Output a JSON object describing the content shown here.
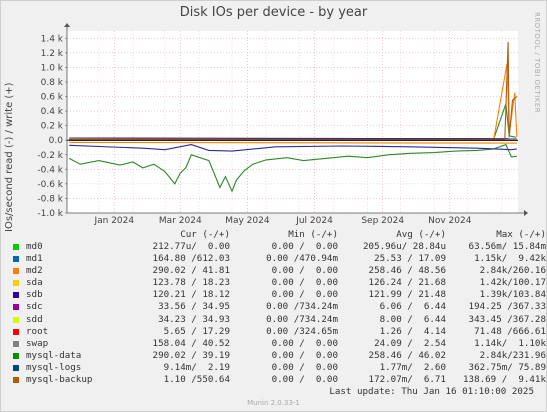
{
  "chart_data": {
    "type": "line",
    "title": "Disk IOs per device - by year",
    "ylabel": "IOs/second read (-) / write (+)",
    "ylim": [
      -1000,
      1500
    ],
    "y_ticks": [
      "1.4 k",
      "1.2 k",
      "1.0 k",
      "0.8 k",
      "0.6 k",
      "0.4 k",
      "0.2 k",
      "0.0",
      "-0.2 k",
      "-0.4 k",
      "-0.6 k",
      "-0.8 k",
      "-1.0 k"
    ],
    "y_tick_values": [
      1400,
      1200,
      1000,
      800,
      600,
      400,
      200,
      0,
      -200,
      -400,
      -600,
      -800,
      -1000
    ],
    "x_range": [
      "2023-12-03",
      "2025-01-16"
    ],
    "x_ticks": [
      {
        "label": "Jan 2024",
        "date": "2024-01-15"
      },
      {
        "label": "Mar 2024",
        "date": "2024-03-15"
      },
      {
        "label": "May 2024",
        "date": "2024-05-15"
      },
      {
        "label": "Jul 2024",
        "date": "2024-07-15"
      },
      {
        "label": "Sep 2024",
        "date": "2024-09-15"
      },
      {
        "label": "Nov 2024",
        "date": "2024-11-15"
      }
    ],
    "grid": true,
    "series_summary_note": "",
    "series": [
      {
        "name": "mysql-data",
        "color": "#2a8a2a",
        "write": [
          [
            "2023-12-05",
            10
          ],
          [
            "2024-03-01",
            15
          ],
          [
            "2024-04-10",
            10
          ],
          [
            "2024-07-01",
            12
          ],
          [
            "2024-10-01",
            14
          ],
          [
            "2024-12-25",
            20
          ],
          [
            "2025-01-05",
            500
          ],
          [
            "2025-01-08",
            60
          ],
          [
            "2025-01-14",
            40
          ]
        ],
        "read": [
          [
            "2023-12-05",
            -250
          ],
          [
            "2023-12-15",
            -330
          ],
          [
            "2024-01-01",
            -280
          ],
          [
            "2024-01-20",
            -340
          ],
          [
            "2024-02-01",
            -300
          ],
          [
            "2024-02-10",
            -380
          ],
          [
            "2024-02-20",
            -330
          ],
          [
            "2024-03-01",
            -430
          ],
          [
            "2024-03-10",
            -600
          ],
          [
            "2024-03-15",
            -450
          ],
          [
            "2024-03-20",
            -380
          ],
          [
            "2024-03-25",
            -200
          ],
          [
            "2024-04-10",
            -280
          ],
          [
            "2024-04-20",
            -650
          ],
          [
            "2024-04-25",
            -500
          ],
          [
            "2024-05-01",
            -700
          ],
          [
            "2024-05-05",
            -550
          ],
          [
            "2024-05-12",
            -420
          ],
          [
            "2024-05-20",
            -330
          ],
          [
            "2024-06-01",
            -270
          ],
          [
            "2024-06-20",
            -240
          ],
          [
            "2024-07-05",
            -280
          ],
          [
            "2024-07-25",
            -250
          ],
          [
            "2024-08-15",
            -220
          ],
          [
            "2024-09-01",
            -240
          ],
          [
            "2024-09-20",
            -200
          ],
          [
            "2024-10-10",
            -180
          ],
          [
            "2024-11-01",
            -170
          ],
          [
            "2024-11-20",
            -150
          ],
          [
            "2024-12-10",
            -140
          ],
          [
            "2024-12-25",
            -120
          ],
          [
            "2025-01-05",
            -60
          ],
          [
            "2025-01-10",
            -230
          ],
          [
            "2025-01-15",
            -220
          ]
        ]
      },
      {
        "name": "md2",
        "color": "#ff7f00",
        "write": [
          [
            "2023-12-05",
            12
          ],
          [
            "2024-12-25",
            20
          ],
          [
            "2025-01-06",
            1050
          ],
          [
            "2025-01-08",
            80
          ],
          [
            "2025-01-13",
            650
          ],
          [
            "2025-01-15",
            40
          ]
        ],
        "read": [
          [
            "2023-12-05",
            -30
          ],
          [
            "2025-01-15",
            -40
          ]
        ]
      },
      {
        "name": "sdb",
        "color": "#2a2a9a",
        "write": [
          [
            "2023-12-05",
            30
          ],
          [
            "2025-01-15",
            20
          ]
        ],
        "read": [
          [
            "2023-12-05",
            -70
          ],
          [
            "2024-02-10",
            -110
          ],
          [
            "2024-03-01",
            -130
          ],
          [
            "2024-03-25",
            -60
          ],
          [
            "2024-04-10",
            -140
          ],
          [
            "2024-05-01",
            -150
          ],
          [
            "2024-06-10",
            -90
          ],
          [
            "2024-08-10",
            -80
          ],
          [
            "2024-10-10",
            -90
          ],
          [
            "2024-12-10",
            -110
          ],
          [
            "2025-01-10",
            -130
          ],
          [
            "2025-01-15",
            -120
          ]
        ]
      },
      {
        "name": "mysql-backup",
        "color": "#b05c10",
        "write": [
          [
            "2023-12-05",
            5
          ],
          [
            "2025-01-04",
            10
          ],
          [
            "2025-01-07",
            1350
          ],
          [
            "2025-01-08",
            40
          ],
          [
            "2025-01-11",
            550
          ],
          [
            "2025-01-15",
            600
          ]
        ],
        "read": [
          [
            "2023-12-05",
            -2
          ],
          [
            "2025-01-15",
            -2
          ]
        ]
      }
    ]
  },
  "legend": {
    "headers": [
      "Cur (-/+)",
      "Min (-/+)",
      "Avg (-/+)",
      "Max (-/+)"
    ],
    "rows": [
      {
        "name": "md0",
        "color": "#00cc00",
        "cur": "212.77u/  0.00",
        "min": "0.00 /  0.00",
        "avg": "205.96u/ 28.84u",
        "max": "63.56m/ 15.84m"
      },
      {
        "name": "md1",
        "color": "#0066b3",
        "cur": "164.80 /612.03",
        "min": "0.00 /470.94m",
        "avg": "25.53 / 17.09",
        "max": "1.15k/  9.42k"
      },
      {
        "name": "md2",
        "color": "#ff8000",
        "cur": "290.02 / 41.81",
        "min": "0.00 /  0.00",
        "avg": "258.46 / 48.56",
        "max": "2.84k/260.16"
      },
      {
        "name": "sda",
        "color": "#ffcc00",
        "cur": "123.78 / 18.23",
        "min": "0.00 /  0.00",
        "avg": "126.24 / 21.68",
        "max": "1.42k/100.17"
      },
      {
        "name": "sdb",
        "color": "#330099",
        "cur": "120.21 / 18.12",
        "min": "0.00 /  0.00",
        "avg": "121.99 / 21.48",
        "max": "1.39k/103.84"
      },
      {
        "name": "sdc",
        "color": "#990099",
        "cur": "33.56 / 34.95",
        "min": "0.00 /734.24m",
        "avg": "6.06 /  6.44",
        "max": "194.25 /367.33"
      },
      {
        "name": "sdd",
        "color": "#ccff00",
        "cur": "34.23 / 34.93",
        "min": "0.00 /734.24m",
        "avg": "8.00 /  6.44",
        "max": "343.45 /367.28"
      },
      {
        "name": "root",
        "color": "#ff0000",
        "cur": "5.65 / 17.29",
        "min": "0.00 /324.65m",
        "avg": "1.26 /  4.14",
        "max": "71.48 /666.61"
      },
      {
        "name": "swap",
        "color": "#808080",
        "cur": "158.04 / 40.52",
        "min": "0.00 /  0.00",
        "avg": "24.09 /  2.54",
        "max": "1.14k/  1.10k"
      },
      {
        "name": "mysql-data",
        "color": "#008f00",
        "cur": "290.02 / 39.19",
        "min": "0.00 /  0.00",
        "avg": "258.46 / 46.02",
        "max": "2.84k/231.96"
      },
      {
        "name": "mysql-logs",
        "color": "#00487d",
        "cur": "9.14m/  2.19",
        "min": "0.00 /  0.00",
        "avg": "1.77m/  2.60",
        "max": "362.75m/ 75.89"
      },
      {
        "name": "mysql-backup",
        "color": "#b35a00",
        "cur": "1.10 /550.64",
        "min": "0.00 /  0.00",
        "avg": "172.07m/  6.71",
        "max": "138.69 /  9.41k"
      }
    ]
  },
  "last_update": "Last update:  Thu Jan 16 01:10:00 2025",
  "side_text": "RRDTOOL / TOBI OETIKER",
  "footer": "Munin 2.0.33-1"
}
